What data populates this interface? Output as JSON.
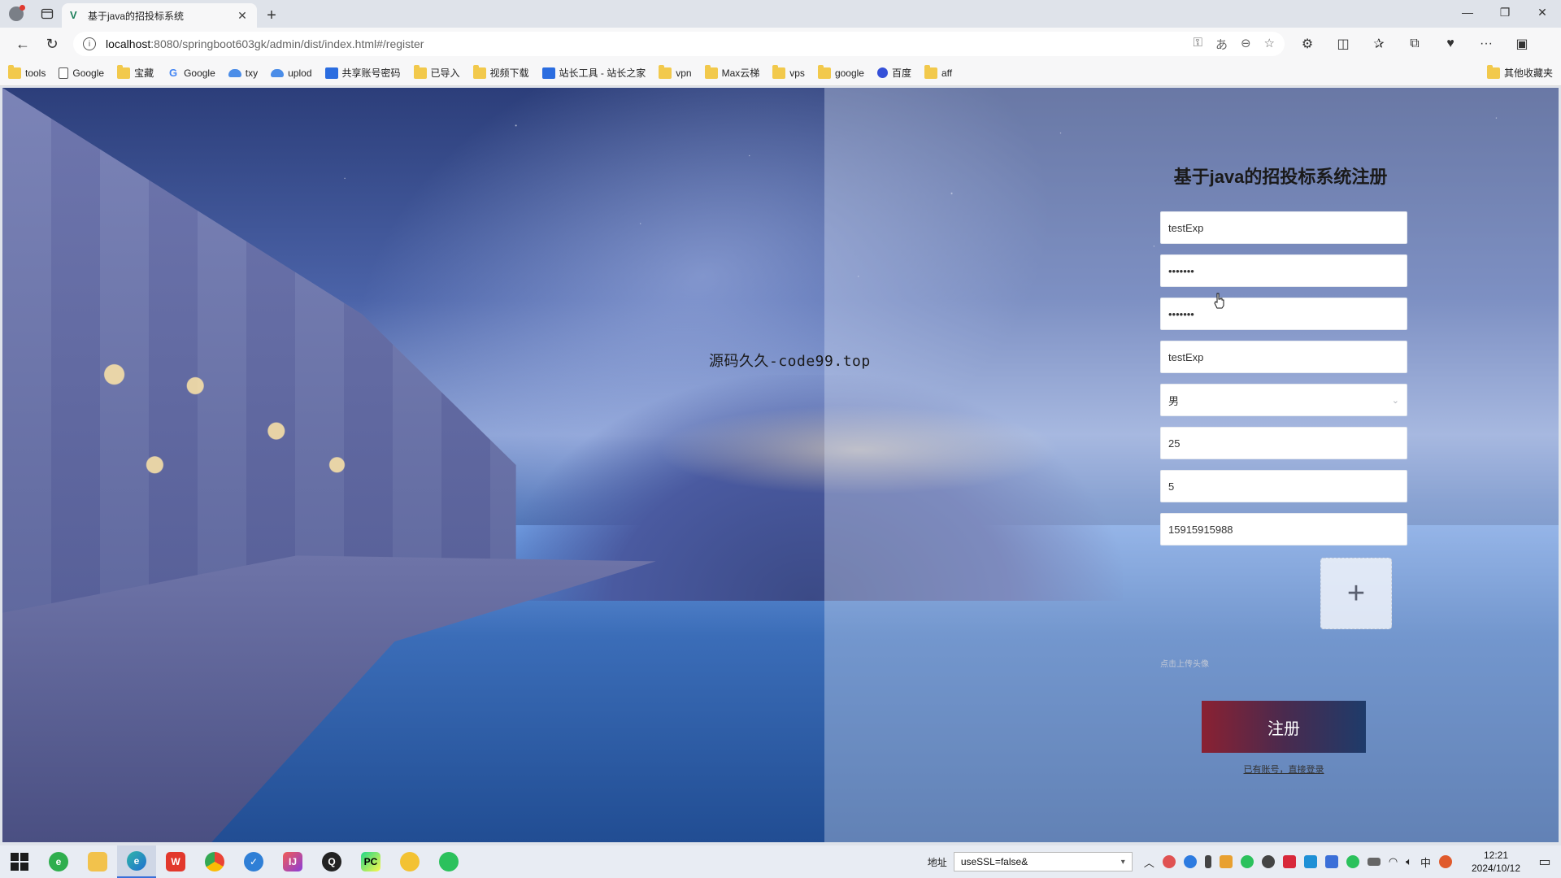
{
  "browser": {
    "tab_title": "基于java的招投标系统",
    "url_host": "localhost",
    "url_rest": ":8080/springboot603gk/admin/dist/index.html#/register",
    "bookmarks": [
      "tools",
      "Google",
      "宝藏",
      "Google",
      "txy",
      "uplod",
      "共享账号密码",
      "已导入",
      "视频下载",
      "站长工具 - 站长之家",
      "vpn",
      "Max云梯",
      "vps",
      "google",
      "百度",
      "aff"
    ],
    "other_bookmarks": "其他收藏夹"
  },
  "page": {
    "watermark": "源码久久-code99.top",
    "form": {
      "title": "基于java的招投标系统注册",
      "username": "testExp",
      "password": "•••••••",
      "confirm_password": "•••••••",
      "name": "testExp",
      "gender": "男",
      "age": "25",
      "work_years": "5",
      "phone": "15915915988",
      "upload_plus": "+",
      "upload_hint": "点击上传头像",
      "register_button": "注册",
      "login_link": "已有账号，直接登录"
    }
  },
  "taskbar": {
    "address_label": "地址",
    "address_value": "useSSL=false&",
    "ime": "中",
    "time": "12:21",
    "date": "2024/10/12"
  },
  "colors": {
    "button_gradient_start": "#8a2132",
    "button_gradient_end": "#1e3b6a"
  }
}
